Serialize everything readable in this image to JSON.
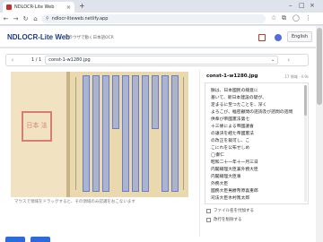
{
  "browser": {
    "tab_title": "NDLOCR-Lite Web",
    "url": "ndlocr-liteweb.netlify.app"
  },
  "header": {
    "app_title": "NDLOCR-Lite Web",
    "subtitle": "ブラウザで動く日本語OCR",
    "lang_button": "English"
  },
  "pager": {
    "count": "1 / 1",
    "selected_file": "const-1-w1280.jpg"
  },
  "image_panel": {
    "seal_text": "日本 法",
    "caption": "マウスで領域をドラッグすると、その領域のみ認識をおこないます"
  },
  "result": {
    "file_name": "const-1-w1280.jpg",
    "meta": "17 領域 · 4.9s",
    "lines": [
      "朕は、日本國民の總意に",
      "基いて、新日本建設の礎が、",
      "定まるに至つたことを、深く",
      "よろこび、樞密顧問の諮詢及び諮問の諮問",
      "供奉び帝國憲法第七",
      "十三條による帝國議會",
      "の議決を經た帝國憲法",
      "の改正を裁可し、こ",
      "こにれを公布せしめ",
      "◯御仁",
      "昭和二十一年十一月三日",
      "内閣總理大臣兼外務大臣",
      "内閣總理大臣事",
      "外務大臣",
      "國務大臣男爵幣原喜重郎",
      "司法大臣木村篤太郎"
    ],
    "options": [
      "ファイル名を付加する",
      "改行を削除する"
    ]
  },
  "colors": {
    "accent": "#1f3b82",
    "highlight": "#7896e6",
    "seal": "#d97d70"
  }
}
